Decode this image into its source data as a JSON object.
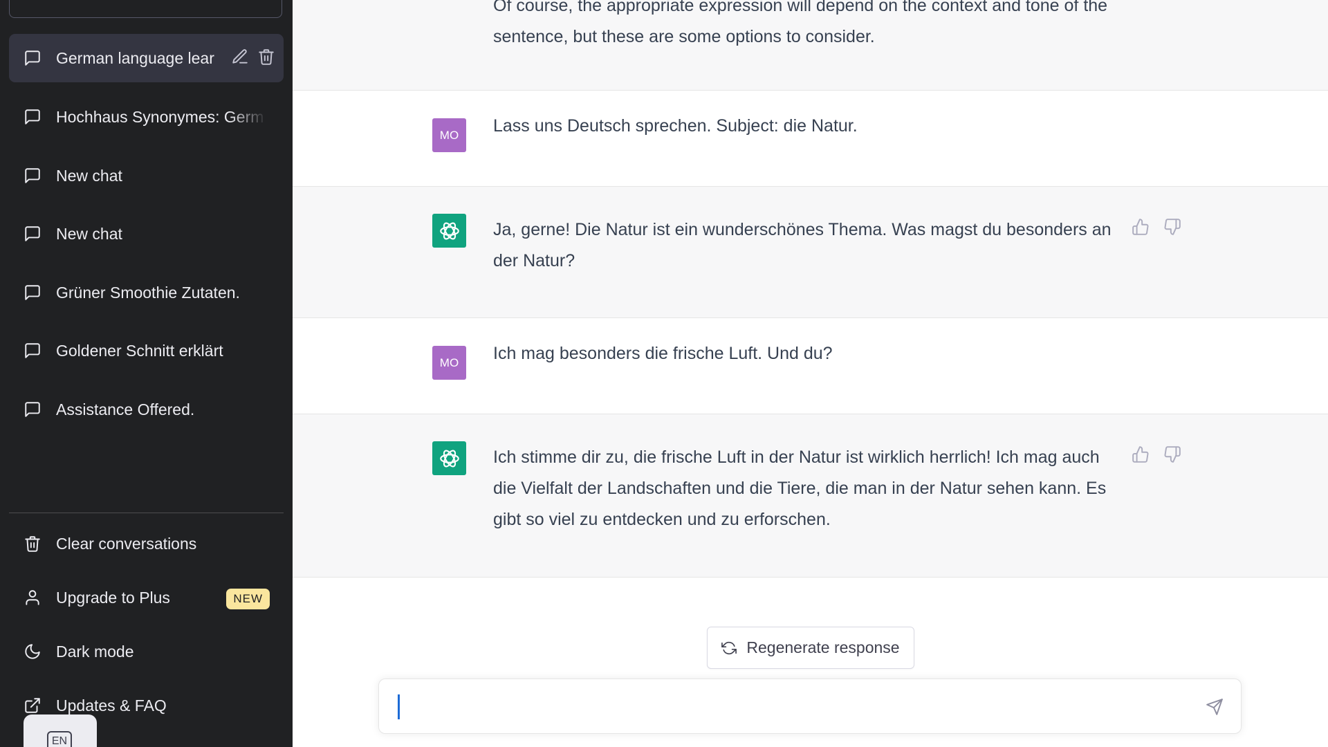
{
  "sidebar": {
    "conversations": [
      {
        "label": "German language lear"
      },
      {
        "label": "Hochhaus Synonymes: Germ"
      },
      {
        "label": "New chat"
      },
      {
        "label": "New chat"
      },
      {
        "label": "Grüner Smoothie Zutaten."
      },
      {
        "label": "Goldener Schnitt erklärt"
      },
      {
        "label": "Assistance Offered."
      }
    ],
    "bottom": {
      "clear": "Clear conversations",
      "upgrade": "Upgrade to Plus",
      "upgrade_badge": "NEW",
      "dark_mode": "Dark mode",
      "updates": "Updates & FAQ"
    },
    "language_button": "EN"
  },
  "chat": {
    "messages": [
      {
        "role": "assistant",
        "text": "Of course, the appropriate expression will depend on the context and tone of the sentence, but these are some options to consider."
      },
      {
        "role": "user",
        "avatar": "MO",
        "text": "Lass uns Deutsch sprechen. Subject: die Natur."
      },
      {
        "role": "assistant",
        "text": "Ja, gerne! Die Natur ist ein wunderschönes Thema. Was magst du besonders an der Natur?"
      },
      {
        "role": "user",
        "avatar": "MO",
        "text": "Ich mag besonders die frische Luft. Und du?"
      },
      {
        "role": "assistant",
        "text": "Ich stimme dir zu, die frische Luft in der Natur ist wirklich herrlich! Ich mag auch die Vielfalt der Landschaften und die Tiere, die man in der Natur sehen kann. Es gibt so viel zu entdecken und zu erforschen."
      }
    ],
    "regenerate_label": "Regenerate response",
    "input_value": ""
  },
  "colors": {
    "sidebar_bg": "#202123",
    "user_avatar": "#a86ac6",
    "assistant_avatar": "#10a37f",
    "new_badge": "#fae69e"
  }
}
